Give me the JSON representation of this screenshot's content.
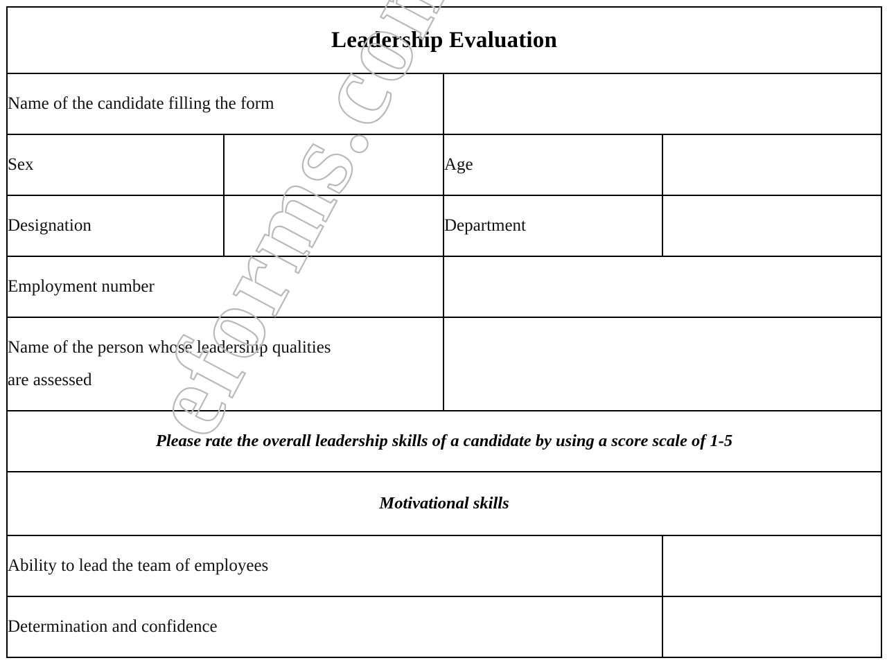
{
  "document": {
    "title": "Leadership Evaluation",
    "watermark_text": "eforms.com"
  },
  "fields": {
    "candidate_name_label": "Name of the candidate filling the form",
    "sex_label": "Sex",
    "age_label": "Age",
    "designation_label": "Designation",
    "department_label": "Department",
    "employment_number_label": "Employment number",
    "assessed_person_label_line1": "Name of the person whose leadership qualities",
    "assessed_person_label_line2": "are assessed",
    "candidate_name_value": "",
    "sex_value": "",
    "age_value": "",
    "designation_value": "",
    "department_value": "",
    "employment_number_value": "",
    "assessed_person_value": ""
  },
  "instructions": {
    "rating_scale_note": "Please rate the overall leadership skills of a candidate by using a score scale of 1-5"
  },
  "sections": [
    {
      "heading": "Motivational skills",
      "items": [
        {
          "label": "Ability to lead the team of employees",
          "score": ""
        },
        {
          "label": "Determination and confidence",
          "score": ""
        }
      ]
    }
  ],
  "colors": {
    "title_bar": "#c2c2c2",
    "label_cell": "#d9d9d9",
    "value_cell": "#ffffff",
    "border": "#000000",
    "watermark": "#b9b9b9"
  }
}
